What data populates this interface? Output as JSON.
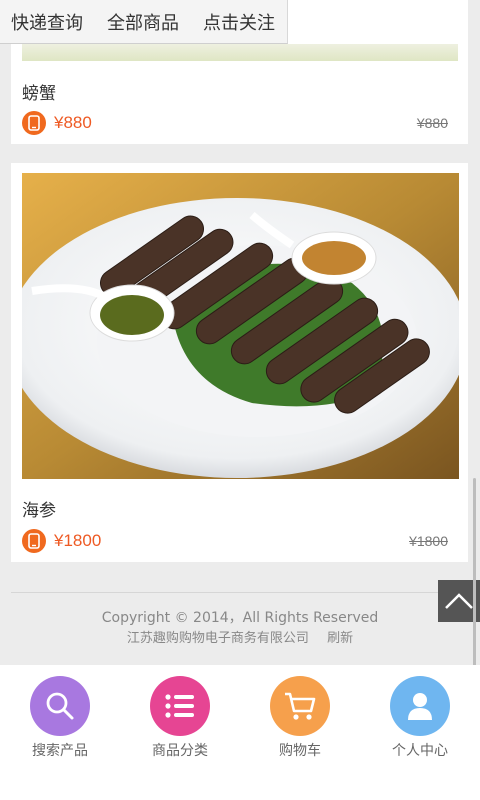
{
  "topbar": {
    "items": [
      "快递查询",
      "全部商品",
      "点击关注"
    ]
  },
  "products": [
    {
      "name": "螃蟹",
      "price": "¥880",
      "old_price": "¥880"
    },
    {
      "name": "海参",
      "price": "¥1800",
      "old_price": "¥1800"
    }
  ],
  "footer": {
    "copyright": "Copyright © 2014，All Rights Reserved",
    "company": "江苏趣购购物电子商务有限公司",
    "refresh": "刷新"
  },
  "bottom_nav": [
    {
      "label": "搜索产品",
      "icon": "search-icon",
      "color": "#a878e0"
    },
    {
      "label": "商品分类",
      "icon": "list-icon",
      "color": "#e64593"
    },
    {
      "label": "购物车",
      "icon": "cart-icon",
      "color": "#f6a04c"
    },
    {
      "label": "个人中心",
      "icon": "user-icon",
      "color": "#6fb6f0"
    }
  ],
  "colors": {
    "price": "#ee5a24",
    "badge": "#f0691e"
  }
}
